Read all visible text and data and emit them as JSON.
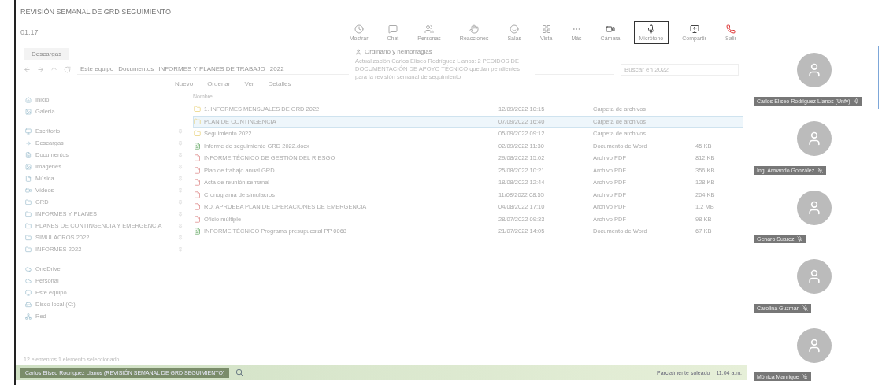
{
  "window": {
    "title": "REVISIÓN SEMANAL DE GRD SEGUIMIENTO"
  },
  "meeting_timer": "01:17",
  "toolbar": [
    {
      "kind": "plain",
      "label": "Mostrar"
    },
    {
      "kind": "plain",
      "label": "Chat"
    },
    {
      "kind": "plain",
      "label": "Personas"
    },
    {
      "kind": "plain",
      "label": "Reacciones"
    },
    {
      "kind": "plain",
      "label": "Salas"
    },
    {
      "kind": "plain",
      "label": "Vista"
    },
    {
      "kind": "plain",
      "label": "Más"
    },
    {
      "kind": "strong",
      "label": "Cámara",
      "selected": false
    },
    {
      "kind": "strong",
      "label": "Micrófono",
      "selected": true
    },
    {
      "kind": "strong",
      "label": "Compartir",
      "selected": false
    },
    {
      "kind": "leave",
      "label": "Salir"
    }
  ],
  "explorer": {
    "tab": "Descargas",
    "breadcrumb": [
      "Este equipo",
      "Documentos",
      "INFORMES Y PLANES DE TRABAJO",
      "2022"
    ],
    "search": {
      "placeholder": "Buscar en 2022"
    },
    "commands": [
      "Nuevo",
      "Ordenar",
      "Ver",
      "Detalles"
    ],
    "column_header": "Nombre",
    "nav": [
      {
        "label": "Inicio",
        "pinned": false
      },
      {
        "label": "Galería",
        "pinned": false
      },
      {
        "label": "Escritorio",
        "pinned": true
      },
      {
        "label": "Descargas",
        "pinned": true
      },
      {
        "label": "Documentos",
        "pinned": true
      },
      {
        "label": "Imágenes",
        "pinned": true
      },
      {
        "label": "Música",
        "pinned": true
      },
      {
        "label": "Vídeos",
        "pinned": true
      },
      {
        "label": "GRD",
        "pinned": true
      },
      {
        "label": "INFORMES Y PLANES",
        "pinned": true
      },
      {
        "label": "PLANES DE CONTINGENCIA Y EMERGENCIA",
        "pinned": true
      },
      {
        "label": "SIMULACROS 2022",
        "pinned": true
      },
      {
        "label": "INFORMES 2022",
        "pinned": true
      },
      {
        "label": "OneDrive",
        "pinned": false
      },
      {
        "label": "Personal",
        "pinned": false
      },
      {
        "label": "Este equipo",
        "pinned": false
      },
      {
        "label": "Disco local (C:)",
        "pinned": false
      },
      {
        "label": "Red",
        "pinned": false
      }
    ],
    "files": [
      {
        "kind": "folder",
        "name": "1. INFORMES MENSUALES DE GRD 2022",
        "date": "12/09/2022 10:15",
        "type": "Carpeta de archivos",
        "selected": false
      },
      {
        "kind": "folder",
        "name": "PLAN DE CONTINGENCIA",
        "date": "07/09/2022 16:40",
        "type": "Carpeta de archivos",
        "selected": true
      },
      {
        "kind": "folder",
        "name": "Seguimiento 2022",
        "date": "05/09/2022 09:12",
        "type": "Carpeta de archivos",
        "selected": false
      },
      {
        "kind": "doc",
        "name": "Informe de seguimiento GRD 2022.docx",
        "date": "02/09/2022 11:30",
        "type": "Documento de Word",
        "size": "45 KB",
        "selected": false
      },
      {
        "kind": "pdf",
        "name": "INFORME TÉCNICO DE GESTIÓN DEL RIESGO",
        "date": "29/08/2022 15:02",
        "type": "Archivo PDF",
        "size": "812 KB",
        "selected": false
      },
      {
        "kind": "pdf",
        "name": "Plan de trabajo anual GRD",
        "date": "25/08/2022 10:21",
        "type": "Archivo PDF",
        "size": "356 KB",
        "selected": false
      },
      {
        "kind": "pdf",
        "name": "Acta de reunión semanal",
        "date": "18/08/2022 12:44",
        "type": "Archivo PDF",
        "size": "128 KB",
        "selected": false
      },
      {
        "kind": "pdf",
        "name": "Cronograma de simulacros",
        "date": "11/08/2022 08:55",
        "type": "Archivo PDF",
        "size": "204 KB",
        "selected": false
      },
      {
        "kind": "pdf",
        "name": "RD. APRUEBA PLAN DE OPERACIONES DE EMERGENCIA",
        "date": "04/08/2022 17:10",
        "type": "Archivo PDF",
        "size": "1.2 MB",
        "selected": false
      },
      {
        "kind": "pdf",
        "name": "Oficio múltiple",
        "date": "28/07/2022 09:33",
        "type": "Archivo PDF",
        "size": "98 KB",
        "selected": false
      },
      {
        "kind": "doc",
        "name": "INFORME TÉCNICO Programa presupuestal PP 0068",
        "date": "21/07/2022 14:05",
        "type": "Documento de Word",
        "size": "67 KB",
        "selected": false
      }
    ],
    "status": "12 elementos   1 elemento seleccionado"
  },
  "notification": {
    "title": "Ordinario y hemorragias",
    "body": "Actualización Carlos Eliseo Rodríguez Llanos: 2 PEDIDOS DE DOCUMENTACIÓN DE APOYO TÉCNICO quedan pendientes para la revisión semanal de seguimiento"
  },
  "participants": [
    {
      "name": "Carlos Eliseo Rodriguez Llanos (Unfv)",
      "muted": false,
      "selected": true
    },
    {
      "name": "Ing. Armando González",
      "muted": true,
      "selected": false
    },
    {
      "name": "Genaro Suarez",
      "muted": true,
      "selected": false
    },
    {
      "name": "Carolina Guzman",
      "muted": true,
      "selected": false
    },
    {
      "name": "Mónica Manrique",
      "muted": true,
      "selected": false
    }
  ],
  "taskbar": {
    "active_window": "Carlos Eliseo Rodríguez Llanos (REVISIÓN SEMANAL DE GRD SEGUIMIENTO)",
    "weather": "Parcialmente soleado",
    "clock": "11:04 a.m."
  }
}
